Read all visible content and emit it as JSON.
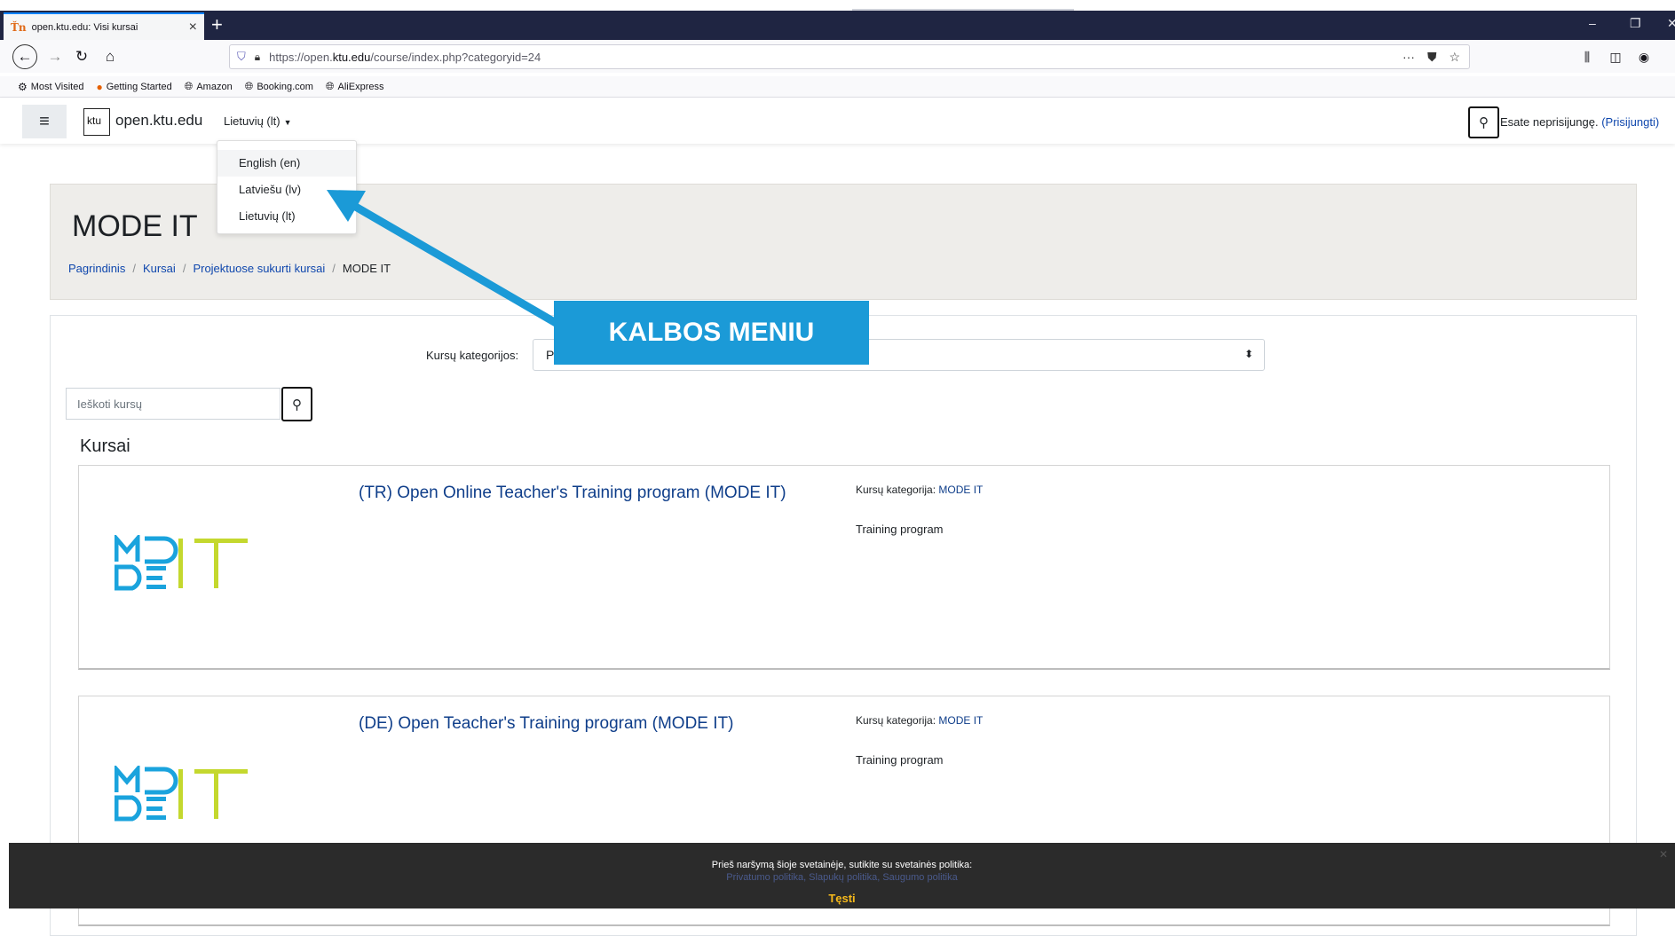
{
  "browser": {
    "tab_title": "open.ktu.edu: Visi kursai",
    "tab_favicon": "ktu-favicon",
    "new_tab": "+",
    "url_prefix": "https://open.",
    "url_domain": "ktu.edu",
    "url_path": "/course/index.php?categoryid=24",
    "url_actions": "···",
    "bookmarks": [
      "Most Visited",
      "Getting Started",
      "Amazon",
      "Booking.com",
      "AliExpress"
    ]
  },
  "header": {
    "logo_text": "ktu",
    "site_name": "open.ktu.edu",
    "language_toggle": "Lietuvių (lt)",
    "login_note": "Esate neprisijungę. ",
    "login_link": "(Prisijungti)"
  },
  "language_menu": {
    "items": [
      "English (en)",
      "Latviešu (lv)",
      "Lietuvių (lt)"
    ]
  },
  "page": {
    "title": "MODE IT",
    "breadcrumb": [
      "Pagrindinis",
      "Kursai",
      "Projektuose sukurti kursai",
      "MODE IT"
    ]
  },
  "main": {
    "category_label": "Kursų kategorijos:",
    "category_value": "P",
    "search_placeholder": "Ieškoti kursų",
    "courses_heading": "Kursai",
    "courses": [
      {
        "name": "(TR) Open Online Teacher's Training program (MODE IT)",
        "category_label": "Kursų kategorija: ",
        "category_value": "MODE IT",
        "summary": "Training program"
      },
      {
        "name": "(DE) Open Teacher's Training program (MODE IT)",
        "category_label": "Kursų kategorija: ",
        "category_value": "MODE IT",
        "summary": "Training program"
      }
    ]
  },
  "cookie": {
    "text": "Prieš naršymą šioje svetainėje, sutikite su svetainės politika:",
    "links": "Privatumo politika, Slapukų politika, Saugumo politika",
    "button": "Tęsti"
  },
  "annotation": {
    "callout_text": "KALBOS MENIU",
    "color": "#1b9ad7"
  },
  "colors": {
    "link": "#0f47ad",
    "modeit_blue": "#1aa3dd",
    "modeit_green": "#c4d82e",
    "titlebar": "#1f2542"
  }
}
